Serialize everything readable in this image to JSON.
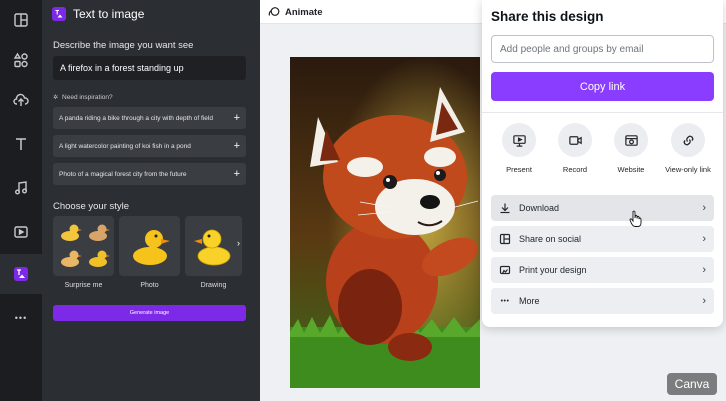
{
  "rail": {
    "icons": [
      "layout-icon",
      "elements-icon",
      "uploads-icon",
      "text-icon",
      "audio-icon",
      "video-icon",
      "text-to-image-icon",
      "more-icon"
    ],
    "more_glyph": "•••"
  },
  "panel": {
    "title": "Text to image",
    "describe_label": "Describe the image you want see",
    "prompt_value": "A firefox in a forest standing up",
    "inspiration_label": "Need inspiration?",
    "suggestions": [
      "A panda riding a bike through a city with depth of field",
      "A light watercolor painting of koi fish in a pond",
      "Photo of a magical forest city from the future"
    ],
    "style_label": "Choose your style",
    "styles": [
      "Surprise me",
      "Photo",
      "Drawing"
    ],
    "next_glyph": "›",
    "generate_label": "Generate image",
    "accent": "#7d2ae8"
  },
  "toolbar": {
    "animate_label": "Animate"
  },
  "share": {
    "title": "Share this design",
    "input_placeholder": "Add people and groups by email",
    "copy_label": "Copy link",
    "accent": "#8b3dff",
    "options": [
      "Present",
      "Record",
      "Website",
      "View-only link"
    ],
    "rows": [
      "Download",
      "Share on social",
      "Print your design",
      "More"
    ],
    "row_chevron": "›"
  },
  "watermark": "Canva"
}
